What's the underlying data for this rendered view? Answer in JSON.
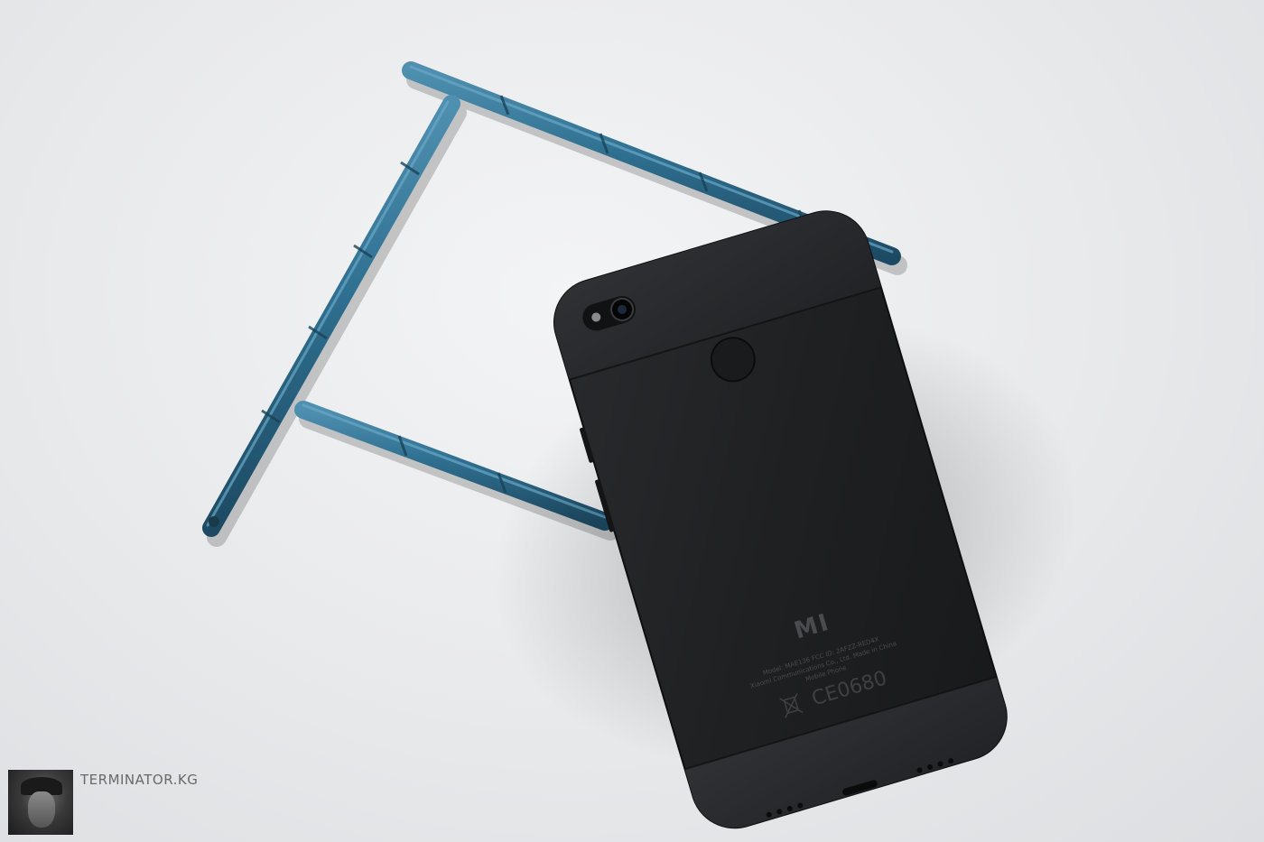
{
  "photo": {
    "subject": "smartphone-back-view",
    "background_color": "#e9eaec",
    "phone_color": "#1e1f21",
    "bracket_color": "#2e6c8c"
  },
  "phone": {
    "logo": "MI",
    "certification": "CE0680",
    "label_line_1": "Model: MAE136   FCC ID: 2AFZZ-RED4X",
    "label_line_2": "Xiaomi Communications Co., Ltd.   Made in China",
    "label_line_3": "Mobile Phone"
  },
  "watermark": {
    "text": "TERMINATOR.KG"
  }
}
